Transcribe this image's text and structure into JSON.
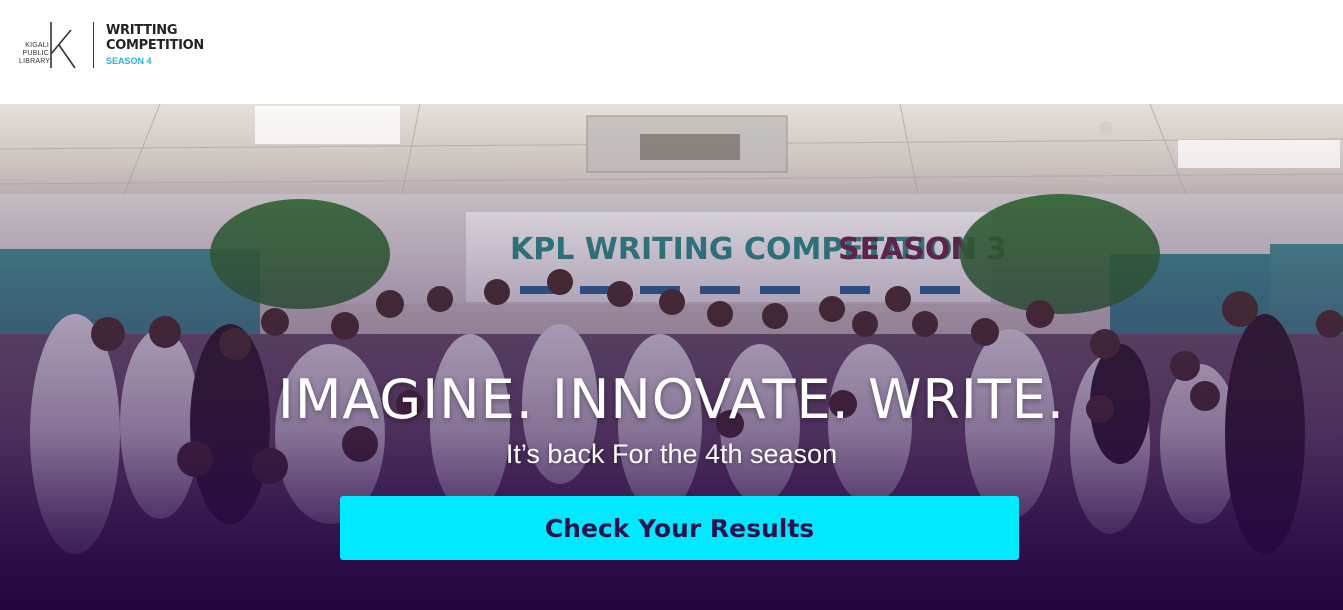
{
  "header": {
    "logo_org": [
      "KIGALI",
      "PUBLIC",
      "LIBRARY"
    ],
    "title_line1": "WRITTING",
    "title_line2": "COMPETITION",
    "season": "SEASON 4"
  },
  "hero": {
    "headline": "IMAGINE. INNOVATE. WRITE.",
    "subline": "It’s back For the 4th season",
    "cta_label": "Check Your Results",
    "banner_text": "KPL WRITING COMPETITION SEASON 3",
    "banner_season": "SEASON 3"
  },
  "colors": {
    "cta_background": "#00e9ff",
    "cta_text": "#2a1450",
    "overlay_bottom": "#240440",
    "season_accent": "#2bb3d6"
  }
}
